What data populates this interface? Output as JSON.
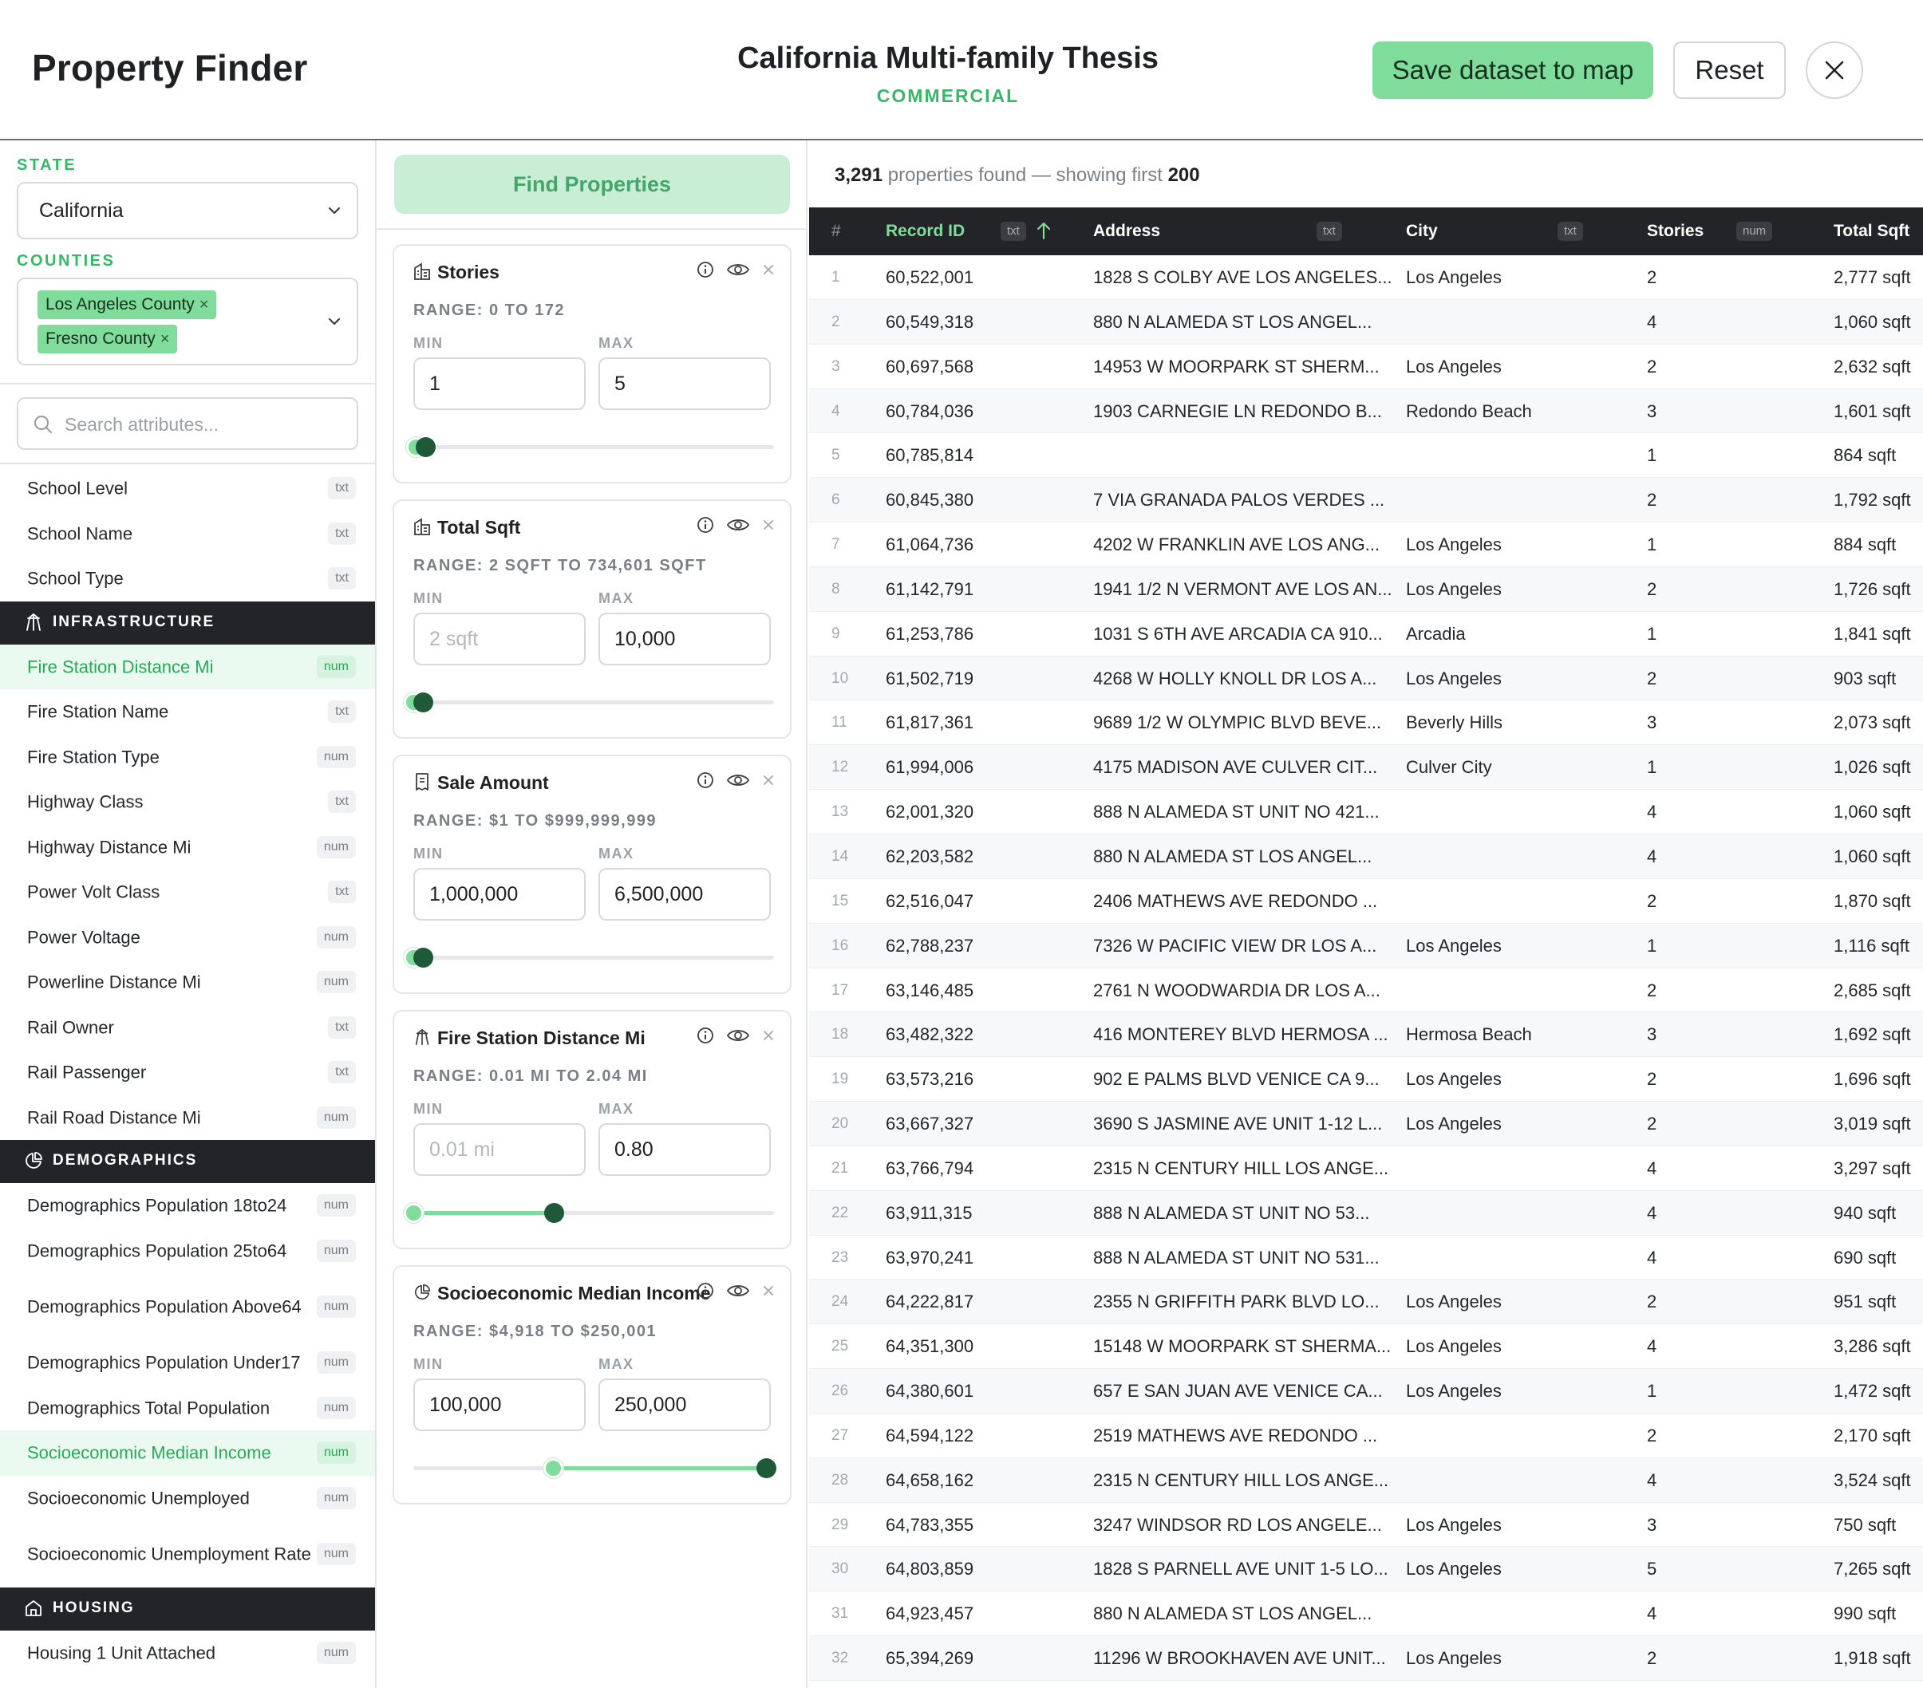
{
  "header": {
    "app_title": "Property Finder",
    "thesis_title": "California Multi-family Thesis",
    "thesis_subtitle": "COMMERCIAL",
    "save_label": "Save dataset to map",
    "reset_label": "Reset",
    "close_icon": "close-icon"
  },
  "sidebar": {
    "state_label": "STATE",
    "state_value": "California",
    "counties_label": "COUNTIES",
    "counties": [
      "Los Angeles County",
      "Fresno County"
    ],
    "search_placeholder": "Search attributes...",
    "school": [
      {
        "label": "School Level",
        "type": "txt"
      },
      {
        "label": "School Name",
        "type": "txt"
      },
      {
        "label": "School Type",
        "type": "txt"
      }
    ],
    "infrastructure": {
      "title": "INFRASTRUCTURE",
      "items": [
        {
          "label": "Fire Station Distance Mi",
          "type": "num"
        },
        {
          "label": "Fire Station Name",
          "type": "txt"
        },
        {
          "label": "Fire Station Type",
          "type": "num"
        },
        {
          "label": "Highway Class",
          "type": "txt"
        },
        {
          "label": "Highway Distance Mi",
          "type": "num"
        },
        {
          "label": "Power Volt Class",
          "type": "txt"
        },
        {
          "label": "Power Voltage",
          "type": "num"
        },
        {
          "label": "Powerline Distance Mi",
          "type": "num"
        },
        {
          "label": "Rail Owner",
          "type": "txt"
        },
        {
          "label": "Rail Passenger",
          "type": "txt"
        },
        {
          "label": "Rail Road Distance Mi",
          "type": "num"
        }
      ]
    },
    "demographics": {
      "title": "DEMOGRAPHICS",
      "items": [
        {
          "label": "Demographics Population 18to24",
          "type": "num"
        },
        {
          "label": "Demographics Population 25to64",
          "type": "num"
        },
        {
          "label": "Demographics Population Above64",
          "type": "num"
        },
        {
          "label": "Demographics Population Under17",
          "type": "num"
        },
        {
          "label": "Demographics Total Population",
          "type": "num"
        },
        {
          "label": "Socioeconomic Median Income",
          "type": "num"
        },
        {
          "label": "Socioeconomic Unemployed",
          "type": "num"
        },
        {
          "label": "Socioeconomic Unemployment Rate",
          "type": "num"
        }
      ]
    },
    "housing": {
      "title": "HOUSING",
      "items": [
        {
          "label": "Housing 1 Unit Attached",
          "type": "num"
        }
      ]
    }
  },
  "filters": {
    "find_label": "Find Properties",
    "min_label": "MIN",
    "max_label": "MAX",
    "cards": [
      {
        "title": "Stories",
        "range": "RANGE: 0 TO 172",
        "min_value": "1",
        "min_placeholder": "",
        "max_value": "5",
        "range_low": 0,
        "range_high": 172,
        "sel_low": 1,
        "sel_high": 5
      },
      {
        "title": "Total Sqft",
        "range": "RANGE: 2 SQFT TO 734,601 SQFT",
        "min_value": "",
        "min_placeholder": "2 sqft",
        "max_value": "10,000",
        "range_low": 2,
        "range_high": 734601,
        "sel_low": 2,
        "sel_high": 10000
      },
      {
        "title": "Sale Amount",
        "range": "RANGE: $1 TO $999,999,999",
        "min_value": "1,000,000",
        "min_placeholder": "",
        "max_value": "6,500,000",
        "range_low": 1,
        "range_high": 999999999,
        "sel_low": 1000000,
        "sel_high": 6500000
      },
      {
        "title": "Fire Station Distance Mi",
        "range": "RANGE: 0.01 MI TO 2.04 MI",
        "min_value": "",
        "min_placeholder": "0.01 mi",
        "max_value": "0.80",
        "range_low": 0.01,
        "range_high": 2.04,
        "sel_low": 0.01,
        "sel_high": 0.8
      },
      {
        "title": "Socioeconomic Median Income",
        "range": "RANGE: $4,918 TO $250,001",
        "min_value": "100,000",
        "min_placeholder": "",
        "max_value": "250,000",
        "range_low": 4918,
        "range_high": 250001,
        "sel_low": 100000,
        "sel_high": 250000
      }
    ]
  },
  "results": {
    "total": "3,291",
    "found_text": "properties found — showing first",
    "shown": "200",
    "columns": {
      "hash": "#",
      "record_id": "Record ID",
      "address": "Address",
      "city": "City",
      "stories": "Stories",
      "total_sqft": "Total Sqft",
      "tag_txt": "txt",
      "tag_num": "num"
    },
    "rows": [
      [
        "1",
        "60,522,001",
        "1828 S COLBY AVE LOS ANGELES...",
        "Los Angeles",
        "2",
        "2,777 sqft"
      ],
      [
        "2",
        "60,549,318",
        "880 N ALAMEDA ST LOS ANGEL...",
        "",
        "4",
        "1,060 sqft"
      ],
      [
        "3",
        "60,697,568",
        "14953 W MOORPARK ST SHERM...",
        "Los Angeles",
        "2",
        "2,632 sqft"
      ],
      [
        "4",
        "60,784,036",
        "1903 CARNEGIE LN REDONDO B...",
        "Redondo Beach",
        "3",
        "1,601 sqft"
      ],
      [
        "5",
        "60,785,814",
        "",
        "",
        "1",
        "864 sqft"
      ],
      [
        "6",
        "60,845,380",
        "7 VIA GRANADA PALOS VERDES ...",
        "",
        "2",
        "1,792 sqft"
      ],
      [
        "7",
        "61,064,736",
        "4202 W FRANKLIN AVE LOS ANG...",
        "Los Angeles",
        "1",
        "884 sqft"
      ],
      [
        "8",
        "61,142,791",
        "1941 1/2 N VERMONT AVE LOS AN...",
        "Los Angeles",
        "2",
        "1,726 sqft"
      ],
      [
        "9",
        "61,253,786",
        "1031 S 6TH AVE ARCADIA CA 910...",
        "Arcadia",
        "1",
        "1,841 sqft"
      ],
      [
        "10",
        "61,502,719",
        "4268 W HOLLY KNOLL DR LOS A...",
        "Los Angeles",
        "2",
        "903 sqft"
      ],
      [
        "11",
        "61,817,361",
        "9689 1/2 W OLYMPIC BLVD BEVE...",
        "Beverly Hills",
        "3",
        "2,073 sqft"
      ],
      [
        "12",
        "61,994,006",
        "4175 MADISON AVE CULVER CIT...",
        "Culver City",
        "1",
        "1,026 sqft"
      ],
      [
        "13",
        "62,001,320",
        "888 N ALAMEDA ST UNIT NO 421...",
        "",
        "4",
        "1,060 sqft"
      ],
      [
        "14",
        "62,203,582",
        "880 N ALAMEDA ST LOS ANGEL...",
        "",
        "4",
        "1,060 sqft"
      ],
      [
        "15",
        "62,516,047",
        "2406 MATHEWS AVE REDONDO ...",
        "",
        "2",
        "1,870 sqft"
      ],
      [
        "16",
        "62,788,237",
        "7326 W PACIFIC VIEW DR LOS A...",
        "Los Angeles",
        "1",
        "1,116 sqft"
      ],
      [
        "17",
        "63,146,485",
        "2761 N WOODWARDIA DR LOS A...",
        "",
        "2",
        "2,685 sqft"
      ],
      [
        "18",
        "63,482,322",
        "416 MONTEREY BLVD HERMOSA ...",
        "Hermosa Beach",
        "3",
        "1,692 sqft"
      ],
      [
        "19",
        "63,573,216",
        "902 E PALMS BLVD VENICE CA 9...",
        "Los Angeles",
        "2",
        "1,696 sqft"
      ],
      [
        "20",
        "63,667,327",
        "3690 S JASMINE AVE UNIT 1-12 L...",
        "Los Angeles",
        "2",
        "3,019 sqft"
      ],
      [
        "21",
        "63,766,794",
        "2315 N CENTURY HILL LOS ANGE...",
        "",
        "4",
        "3,297 sqft"
      ],
      [
        "22",
        "63,911,315",
        "888 N ALAMEDA ST UNIT NO 53...",
        "",
        "4",
        "940 sqft"
      ],
      [
        "23",
        "63,970,241",
        "888 N ALAMEDA ST UNIT NO 531...",
        "",
        "4",
        "690 sqft"
      ],
      [
        "24",
        "64,222,817",
        "2355 N GRIFFITH PARK BLVD LO...",
        "Los Angeles",
        "2",
        "951 sqft"
      ],
      [
        "25",
        "64,351,300",
        "15148 W MOORPARK ST SHERMA...",
        "Los Angeles",
        "4",
        "3,286 sqft"
      ],
      [
        "26",
        "64,380,601",
        "657 E SAN JUAN AVE VENICE CA...",
        "Los Angeles",
        "1",
        "1,472 sqft"
      ],
      [
        "27",
        "64,594,122",
        "2519 MATHEWS AVE REDONDO ...",
        "",
        "2",
        "2,170 sqft"
      ],
      [
        "28",
        "64,658,162",
        "2315 N CENTURY HILL LOS ANGE...",
        "",
        "4",
        "3,524 sqft"
      ],
      [
        "29",
        "64,783,355",
        "3247 WINDSOR RD LOS ANGELE...",
        "Los Angeles",
        "3",
        "750 sqft"
      ],
      [
        "30",
        "64,803,859",
        "1828 S PARNELL AVE UNIT 1-5 LO...",
        "Los Angeles",
        "5",
        "7,265 sqft"
      ],
      [
        "31",
        "64,923,457",
        "880 N ALAMEDA ST LOS ANGEL...",
        "",
        "4",
        "990 sqft"
      ],
      [
        "32",
        "65,394,269",
        "11296 W BROOKHAVEN AVE UNIT...",
        "Los Angeles",
        "2",
        "1,918 sqft"
      ]
    ]
  },
  "colors": {
    "accent": "#7fdc9a",
    "accent_text": "#37b866",
    "dark": "#222427",
    "thumb": "#1e5a37"
  }
}
